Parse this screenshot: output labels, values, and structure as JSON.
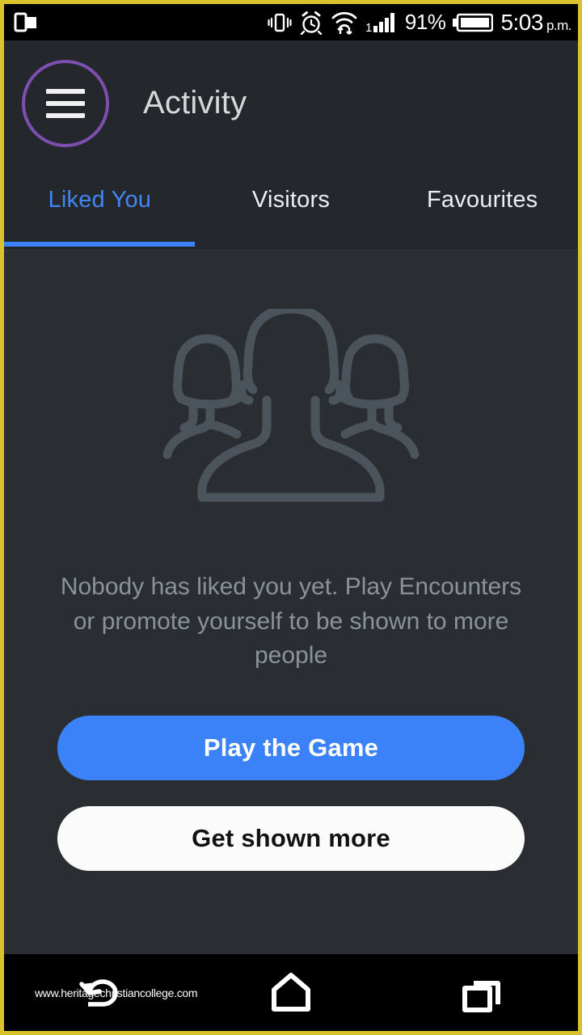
{
  "status_bar": {
    "left_icon": "multi-window-icon",
    "icons": [
      "vibrate-icon",
      "alarm-icon",
      "wifi-icon",
      "signal-icon"
    ],
    "signal_label": "1",
    "battery_percent": "91%",
    "battery_icon": "battery-icon",
    "time": "5:03",
    "period": "p.m."
  },
  "appbar": {
    "menu_icon": "hamburger-menu-icon",
    "title": "Activity",
    "menu_border_color": "#7e4fae"
  },
  "tabs": {
    "items": [
      {
        "label": "Liked You",
        "active": true
      },
      {
        "label": "Visitors",
        "active": false
      },
      {
        "label": "Favourites",
        "active": false
      }
    ],
    "indicator_color": "#3b82f8",
    "active_color": "#4285f4"
  },
  "empty_state": {
    "illustration": "people-group-icon",
    "message": "Nobody has liked you yet. Play Encounters or promote yourself to be shown to more people",
    "primary_button": "Play the Game",
    "secondary_button": "Get shown more",
    "primary_color": "#3b82f8",
    "secondary_color": "#fbfbfb"
  },
  "nav_bar": {
    "back": "back-icon",
    "home": "home-icon",
    "recents": "recents-icon"
  },
  "watermark": "www.heritagechristiancollege.com",
  "frame_color": "#d8c32e"
}
